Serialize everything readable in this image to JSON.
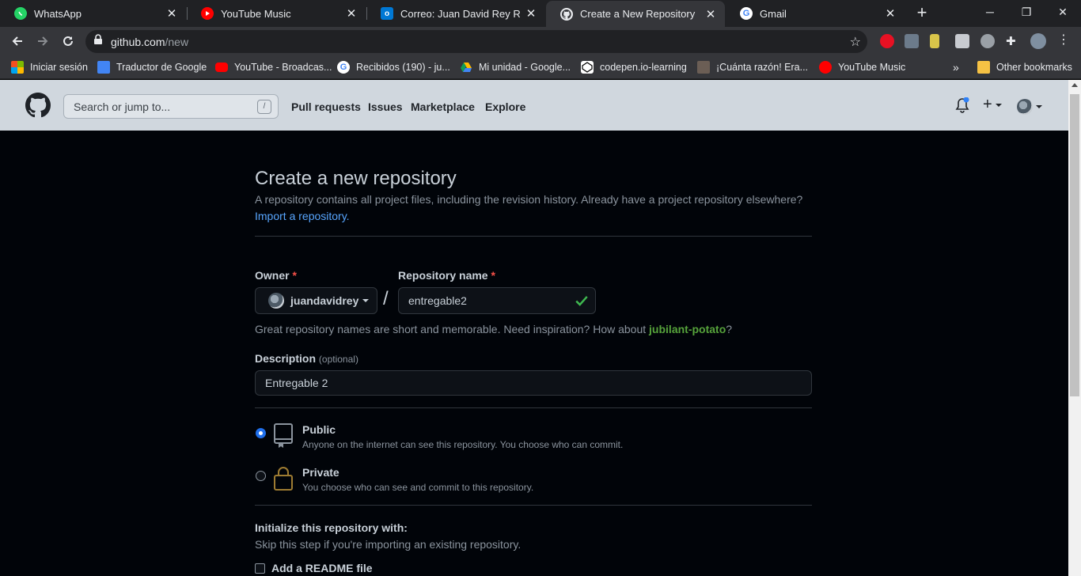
{
  "browser": {
    "tabs": [
      {
        "title": "WhatsApp",
        "icon": "whatsapp-icon",
        "color": "#25d366"
      },
      {
        "title": "YouTube Music",
        "icon": "youtube-music-icon",
        "color": "#ff0000"
      },
      {
        "title": "Correo: Juan David Rey Reina -",
        "icon": "outlook-icon",
        "color": "#0078d4"
      },
      {
        "title": "Create a New Repository",
        "icon": "github-icon",
        "color": "#ffffff"
      },
      {
        "title": "Gmail",
        "icon": "google-icon",
        "color": "#4285f4"
      }
    ],
    "active_tab": 3,
    "url_host": "github.com",
    "url_path": "/new",
    "bookmarks": [
      {
        "label": "Iniciar sesión",
        "icon": "microsoft-icon"
      },
      {
        "label": "Traductor de Google",
        "icon": "google-translate-icon"
      },
      {
        "label": "YouTube - Broadcas...",
        "icon": "youtube-icon"
      },
      {
        "label": "Recibidos (190) - ju...",
        "icon": "google-icon"
      },
      {
        "label": "Mi unidad - Google...",
        "icon": "google-drive-icon"
      },
      {
        "label": "codepen.io-learning",
        "icon": "codepen-icon"
      },
      {
        "label": "¡Cuánta razón! Era...",
        "icon": "cuanta-razon-icon"
      },
      {
        "label": "YouTube Music",
        "icon": "youtube-music-icon"
      }
    ],
    "other_bookmarks": "Other bookmarks",
    "more_bookmarks": "»"
  },
  "github": {
    "search_placeholder": "Search or jump to...",
    "search_shortcut": "/",
    "nav": [
      "Pull requests",
      "Issues",
      "Marketplace",
      "Explore"
    ],
    "accent_link": "#58a6ff"
  },
  "form": {
    "title": "Create a new repository",
    "description": "A repository contains all project files, including the revision history. Already have a project repository elsewhere?",
    "import_link": "Import a repository.",
    "owner_label": "Owner",
    "required_mark": "*",
    "owner_value": "juandavidrey",
    "separator": "/",
    "repo_label": "Repository name",
    "repo_value": "entregable2",
    "hint_prefix": "Great repository names are short and memorable. Need inspiration? How about",
    "hint_suggestion": "jubilant-potato",
    "hint_suffix": "?",
    "desc_label": "Description",
    "desc_optional": "(optional)",
    "desc_value": "Entregable 2",
    "visibility": [
      {
        "title": "Public",
        "desc": "Anyone on the internet can see this repository. You choose who can commit.",
        "selected": true,
        "icon": "repo-icon"
      },
      {
        "title": "Private",
        "desc": "You choose who can see and commit to this repository.",
        "selected": false,
        "icon": "lock-icon"
      }
    ],
    "init_title": "Initialize this repository with:",
    "init_sub": "Skip this step if you're importing an existing repository.",
    "readme_label": "Add a README file"
  }
}
